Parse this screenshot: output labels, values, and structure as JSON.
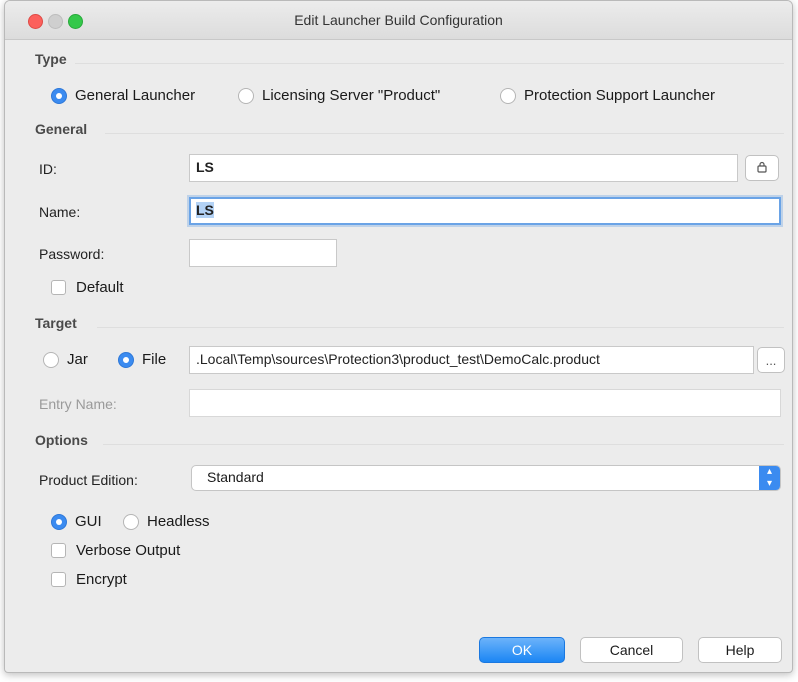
{
  "window": {
    "title": "Edit Launcher Build Configuration"
  },
  "type_section": {
    "heading": "Type",
    "options": [
      "General Launcher",
      "Licensing Server \"Product\"",
      "Protection Support Launcher"
    ],
    "selected": "General Launcher"
  },
  "general": {
    "heading": "General",
    "id_label": "ID:",
    "id_value": "LS",
    "name_label": "Name:",
    "name_value": "LS",
    "password_label": "Password:",
    "password_value": "",
    "default_label": "Default"
  },
  "target": {
    "heading": "Target",
    "jar_label": "Jar",
    "file_label": "File",
    "selected": "File",
    "file_value": ".Local\\Temp\\sources\\Protection3\\product_test\\DemoCalc.product",
    "browse_label": "...",
    "entry_label": "Entry Name:",
    "entry_value": ""
  },
  "options": {
    "heading": "Options",
    "edition_label": "Product Edition:",
    "edition_value": "Standard",
    "gui_label": "GUI",
    "headless_label": "Headless",
    "mode_selected": "GUI",
    "verbose_label": "Verbose Output",
    "encrypt_label": "Encrypt"
  },
  "buttons": {
    "ok": "OK",
    "cancel": "Cancel",
    "help": "Help"
  },
  "colors": {
    "accent": "#3b8bf0",
    "window_bg": "#ececec"
  },
  "icons": {
    "lock": "lock-icon",
    "select_arrows": "chevron-updown-icon"
  }
}
